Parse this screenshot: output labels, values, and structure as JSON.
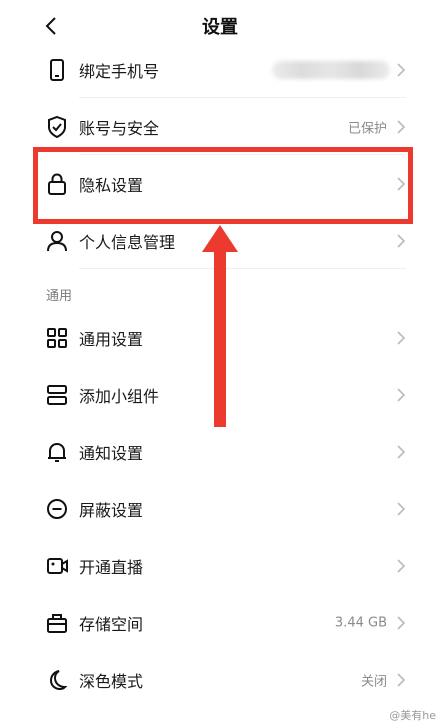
{
  "header": {
    "title": "设置"
  },
  "rows": [
    {
      "label": "绑定手机号",
      "value": "",
      "icon": "phone-icon"
    },
    {
      "label": "账号与安全",
      "value": "已保护",
      "icon": "shield-check-icon"
    },
    {
      "label": "隐私设置",
      "value": "",
      "icon": "lock-icon"
    },
    {
      "label": "个人信息管理",
      "value": "",
      "icon": "person-icon"
    },
    {
      "label": "通用设置",
      "value": "",
      "icon": "grid-icon"
    },
    {
      "label": "添加小组件",
      "value": "",
      "icon": "widget-icon"
    },
    {
      "label": "通知设置",
      "value": "",
      "icon": "bell-icon"
    },
    {
      "label": "屏蔽设置",
      "value": "",
      "icon": "block-icon"
    },
    {
      "label": "开通直播",
      "value": "",
      "icon": "video-icon"
    },
    {
      "label": "存储空间",
      "value": "3.44 GB",
      "icon": "storage-icon"
    },
    {
      "label": "深色模式",
      "value": "关闭",
      "icon": "moon-icon"
    }
  ],
  "section": {
    "general_title": "通用"
  },
  "annotation": {
    "color": "#ec3a2e"
  },
  "watermark": {
    "text": "@美有he"
  }
}
